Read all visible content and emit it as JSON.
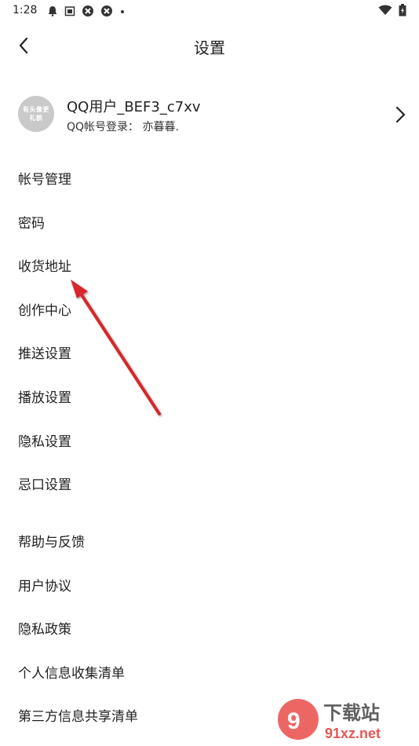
{
  "status_bar": {
    "time": "1:28"
  },
  "header": {
    "title": "设置"
  },
  "profile": {
    "avatar_text": "有头像更礼貌",
    "name": "QQ用户_BEF3_c7xv",
    "login_info": "QQ帐号登录： 亦暮暮."
  },
  "menu": {
    "items": [
      {
        "label": "帐号管理"
      },
      {
        "label": "密码"
      },
      {
        "label": "收货地址"
      },
      {
        "label": "创作中心"
      },
      {
        "label": "推送设置"
      },
      {
        "label": "播放设置"
      },
      {
        "label": "隐私设置"
      },
      {
        "label": "忌口设置"
      },
      {
        "label": "帮助与反馈"
      },
      {
        "label": "用户协议"
      },
      {
        "label": "隐私政策"
      },
      {
        "label": "个人信息收集清单"
      },
      {
        "label": "第三方信息共享清单"
      }
    ]
  },
  "watermark": {
    "brand": "下载站",
    "domain": "91xz.net"
  },
  "colors": {
    "annotation_arrow": "#d8262b",
    "avatar_bg": "#c9c9c9"
  }
}
